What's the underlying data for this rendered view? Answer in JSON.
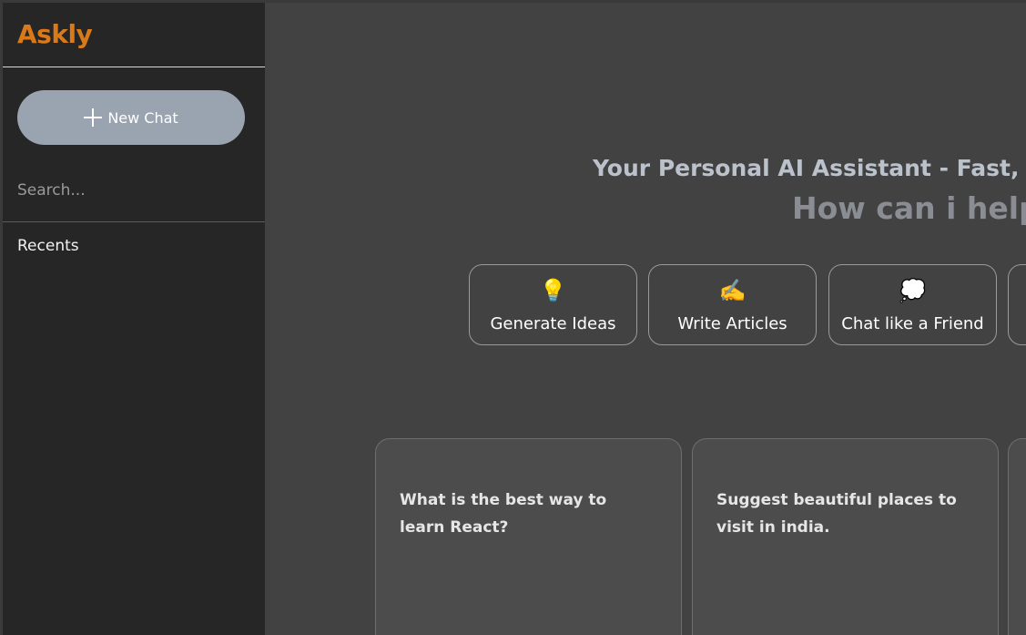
{
  "sidebar": {
    "brand": "Askly",
    "new_chat_label": "New Chat",
    "search_placeholder": "Search...",
    "recents_label": "Recents"
  },
  "main": {
    "tagline": "Your Personal AI Assistant - Fast, F",
    "greeting": "How can i help",
    "chips": [
      {
        "icon": "💡",
        "icon_name": "lightbulb-icon",
        "label": "Generate Ideas"
      },
      {
        "icon": "✍️",
        "icon_name": "writing-hand-icon",
        "label": "Write Articles"
      },
      {
        "icon": "💭",
        "icon_name": "thought-bubble-icon",
        "label": "Chat like a Friend"
      }
    ],
    "cards": [
      {
        "text": "What is the best way to learn React?"
      },
      {
        "text": "Suggest beautiful places to visit in india."
      }
    ]
  },
  "colors": {
    "brand": "#d97a1a",
    "sidebar_bg": "#262626",
    "main_bg": "#424242",
    "button_bg": "#9aa3b0"
  }
}
